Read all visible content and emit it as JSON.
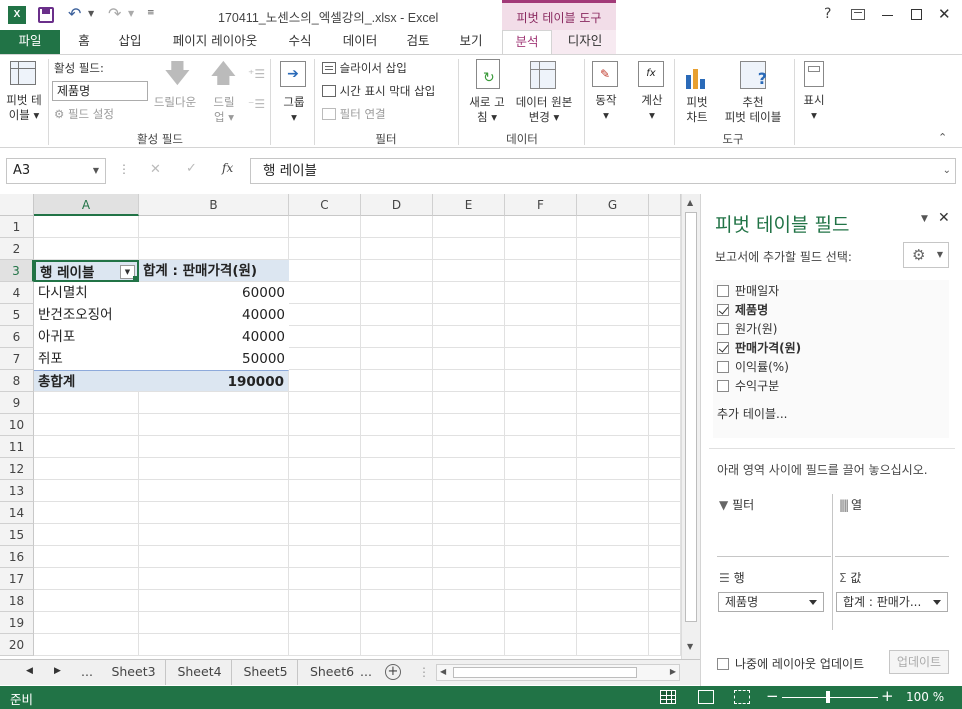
{
  "title": {
    "filename": "170411_노센스의_엑셀강의_.xlsx - Excel",
    "context_tool": "피벗 테이블 도구",
    "help": "?"
  },
  "tabs": [
    "파일",
    "홈",
    "삽입",
    "페이지 레이아웃",
    "수식",
    "데이터",
    "검토",
    "보기",
    "분석",
    "디자인"
  ],
  "ribbon": {
    "pivot_btn": [
      "피벗 테",
      "이블"
    ],
    "active_field_label": "활성 필드:",
    "active_field_value": "제품명",
    "field_settings": "필드 설정",
    "drill_down": "드릴다운",
    "drill_up": [
      "드릴",
      "업"
    ],
    "group_active": "활성 필드",
    "group_btn": "그룹",
    "insert_slicer": "슬라이서 삽입",
    "insert_timeline": "시간 표시 막대 삽입",
    "filter_connections": "필터 연결",
    "group_filter": "필터",
    "refresh": [
      "새로 고",
      "침"
    ],
    "change_source": [
      "데이터 원본",
      "변경"
    ],
    "group_data": "데이터",
    "actions": "동작",
    "calculations": "계산",
    "pivot_chart": [
      "피벗",
      "차트"
    ],
    "recommended": [
      "추천",
      "피벗 테이블"
    ],
    "group_tools": "도구",
    "show": "표시"
  },
  "formula_bar": {
    "name_box": "A3",
    "fx": "fx",
    "content": "행 레이블"
  },
  "columns": [
    "A",
    "B",
    "C",
    "D",
    "E",
    "F",
    "G"
  ],
  "rows": [
    "1",
    "2",
    "3",
    "4",
    "5",
    "6",
    "7",
    "8",
    "9",
    "10",
    "11",
    "12",
    "13",
    "14",
    "15",
    "16",
    "17",
    "18",
    "19",
    "20"
  ],
  "pivot": {
    "header_row_label": "행 레이블",
    "header_value": "합계 : 판매가격(원)",
    "items": [
      {
        "label": "다시멸치",
        "value": "60000"
      },
      {
        "label": "반건조오징어",
        "value": "40000"
      },
      {
        "label": "아귀포",
        "value": "40000"
      },
      {
        "label": "쥐포",
        "value": "50000"
      }
    ],
    "total_label": "총합계",
    "total_value": "190000"
  },
  "sheet_tabs": [
    "...",
    "Sheet3",
    "Sheet4",
    "Sheet5",
    "Sheet6",
    "..."
  ],
  "status": {
    "ready": "준비",
    "zoom": "100 %"
  },
  "field_pane": {
    "title": "피벗 테이블 필드",
    "choose_label": "보고서에 추가할 필드 선택:",
    "fields": [
      {
        "name": "판매일자",
        "checked": false
      },
      {
        "name": "제품명",
        "checked": true
      },
      {
        "name": "원가(원)",
        "checked": false
      },
      {
        "name": "판매가격(원)",
        "checked": true
      },
      {
        "name": "이익률(%)",
        "checked": false
      },
      {
        "name": "수익구분",
        "checked": false
      }
    ],
    "more_tables": "추가 테이블...",
    "drag_hint": "아래 영역 사이에 필드를 끌어 놓으십시오.",
    "area_filter": "필터",
    "area_columns": "열",
    "area_rows": "행",
    "area_values": "값",
    "rows_item": "제품명",
    "values_item": "합계 : 판매가...",
    "defer_update": "나중에 레이아웃 업데이트",
    "update_btn": "업데이트"
  },
  "colors": {
    "excel_green": "#217346",
    "context_pink": "#f2dde8",
    "pivot_blue": "#dce6f1"
  }
}
